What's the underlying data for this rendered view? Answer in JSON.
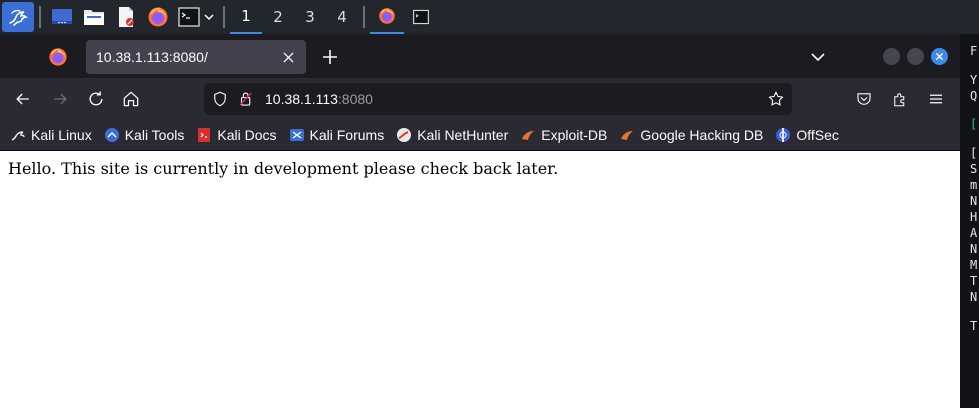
{
  "taskbar": {
    "workspaces": [
      "1",
      "2",
      "3",
      "4"
    ],
    "active_workspace": "1"
  },
  "browser": {
    "tab": {
      "title": "10.38.1.113:8080/"
    },
    "url": {
      "host": "10.38.1.113",
      "port": ":8080"
    },
    "bookmarks": [
      {
        "label": "Kali Linux",
        "icon": "kali-dragon-icon"
      },
      {
        "label": "Kali Tools",
        "icon": "kali-tools-icon"
      },
      {
        "label": "Kali Docs",
        "icon": "kali-docs-icon"
      },
      {
        "label": "Kali Forums",
        "icon": "kali-forums-icon"
      },
      {
        "label": "Kali NetHunter",
        "icon": "kali-nethunter-icon"
      },
      {
        "label": "Exploit-DB",
        "icon": "exploit-db-icon"
      },
      {
        "label": "Google Hacking DB",
        "icon": "ghdb-icon"
      },
      {
        "label": "OffSec",
        "icon": "offsec-icon"
      }
    ]
  },
  "page": {
    "text": "Hello. This site is currently in development please check back later."
  },
  "terminal": {
    "chars": [
      "F",
      "Y",
      "Q",
      "[",
      "S",
      "m",
      "N",
      "H",
      "A",
      "N",
      "M",
      "T",
      "N",
      "T"
    ]
  },
  "colors": {
    "accent": "#3d8be6",
    "taskbar_bg": "#22262d",
    "tabbar_bg": "#1c1b22",
    "toolbar_bg": "#2b2a33"
  }
}
